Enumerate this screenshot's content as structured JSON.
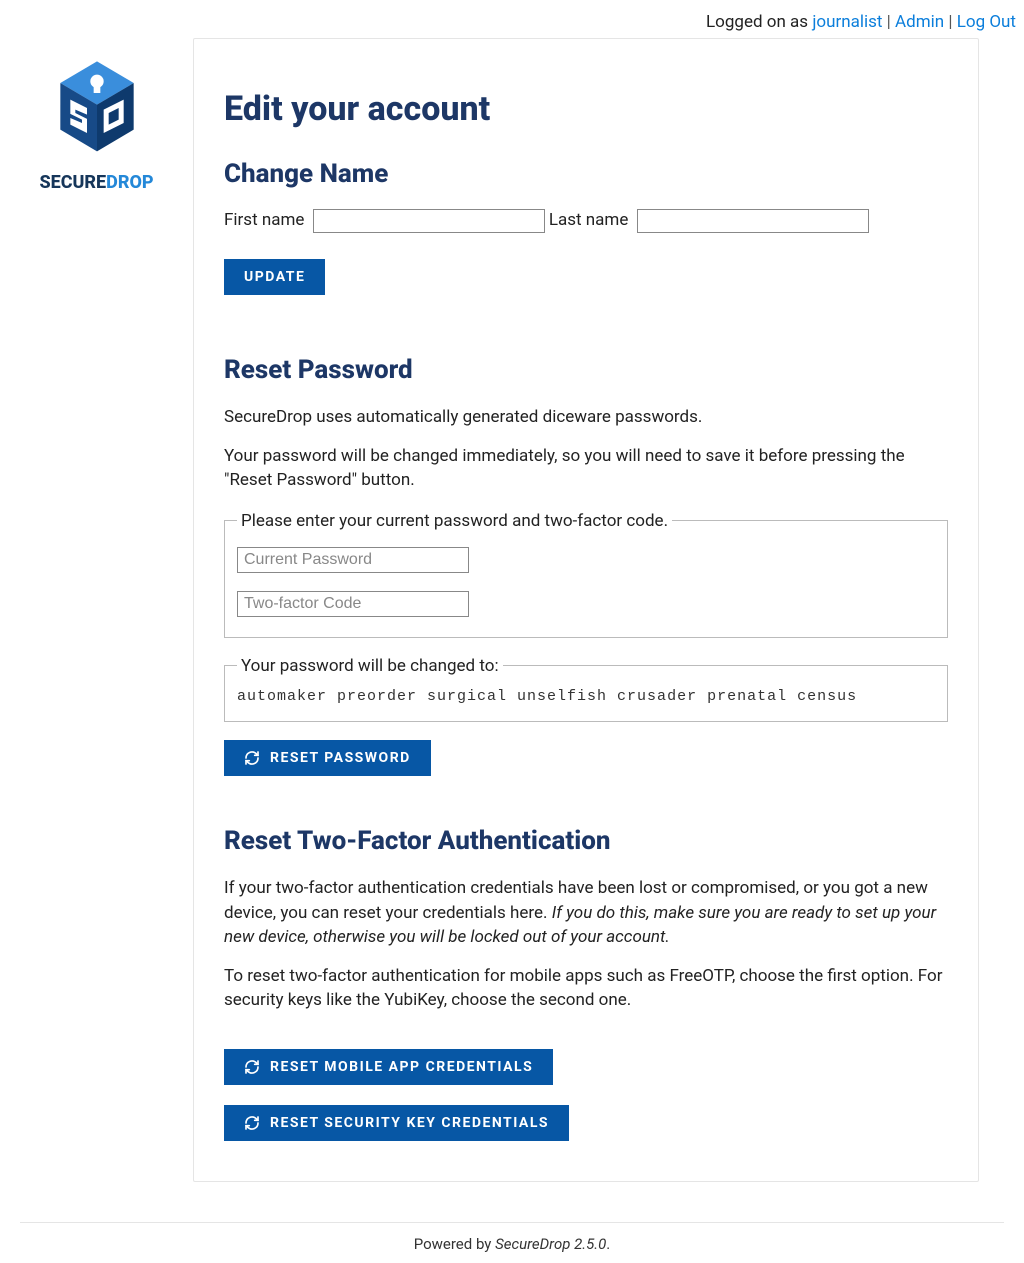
{
  "header": {
    "logged_prefix": "Logged on as ",
    "user_link": "journalist",
    "admin_link": "Admin",
    "logout_link": "Log Out"
  },
  "logo": {
    "word_secure": "SECURE",
    "word_drop": "DROP"
  },
  "page_title": "Edit your account",
  "change_name": {
    "heading": "Change Name",
    "first_label": "First name",
    "last_label": "Last name",
    "first_value": "",
    "last_value": "",
    "update_btn": "UPDATE"
  },
  "reset_password": {
    "heading": "Reset Password",
    "p1": "SecureDrop uses automatically generated diceware passwords.",
    "p2": "Your password will be changed immediately, so you will need to save it before pressing the \"Reset Password\" button.",
    "legend1": "Please enter your current password and two-factor code.",
    "current_placeholder": "Current Password",
    "otp_placeholder": "Two-factor Code",
    "legend2": "Your password will be changed to:",
    "new_password": "automaker preorder surgical unselfish crusader prenatal census",
    "reset_btn": "RESET PASSWORD"
  },
  "reset_2fa": {
    "heading": "Reset Two-Factor Authentication",
    "p1a": "If your two-factor authentication credentials have been lost or compromised, or you got a new device, you can reset your credentials here. ",
    "p1b_italic": "If you do this, make sure you are ready to set up your new device, otherwise you will be locked out of your account.",
    "p2": "To reset two-factor authentication for mobile apps such as FreeOTP, choose the first option. For security keys like the YubiKey, choose the second one.",
    "btn_mobile": "RESET MOBILE APP CREDENTIALS",
    "btn_key": "RESET SECURITY KEY CREDENTIALS"
  },
  "footer": {
    "prefix": "Powered by ",
    "product": "SecureDrop 2.5.0",
    "suffix": "."
  }
}
